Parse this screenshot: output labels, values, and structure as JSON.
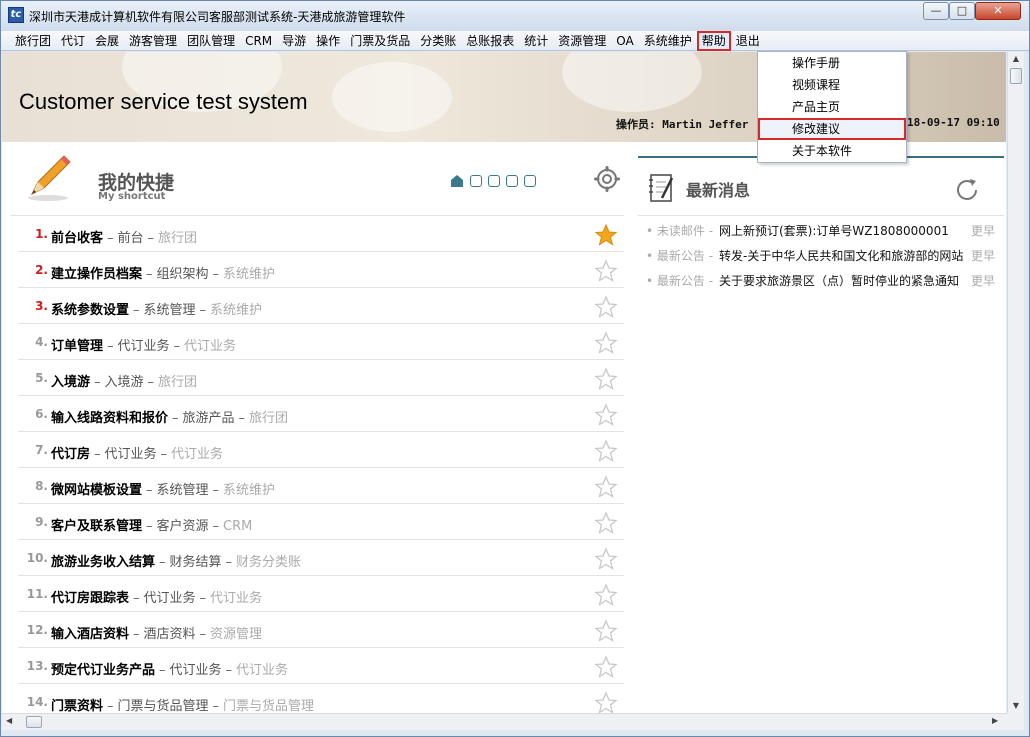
{
  "window": {
    "title": "深圳市天港成计算机软件有限公司客服部测试系统-天港成旅游管理软件",
    "app_icon": "tgc-logo-icon",
    "controls": {
      "minimize": "—",
      "maximize": "□",
      "close": "✕"
    }
  },
  "menubar": {
    "items": [
      "旅行团",
      "代订",
      "会展",
      "游客管理",
      "团队管理",
      "CRM",
      "导游",
      "操作",
      "门票及货品",
      "分类账",
      "总账报表",
      "统计",
      "资源管理",
      "OA",
      "系统维护",
      "帮助",
      "退出"
    ],
    "active": "帮助"
  },
  "help_menu": {
    "items": [
      "操作手册",
      "视频课程",
      "产品主页",
      "修改建议",
      "关于本软件"
    ],
    "highlighted": "修改建议"
  },
  "banner": {
    "title": "Customer service test system",
    "operator": "操作员: Martin Jeffer",
    "datetime": "18-09-17 09:10"
  },
  "shortcuts": {
    "title": "我的快捷",
    "subtitle": "My shortcut",
    "page_count": 5,
    "current_page": 1,
    "items": [
      {
        "num": "1.",
        "name": "前台收客",
        "module": "前台",
        "parent": "旅行团",
        "starred": true,
        "highlight_num": true
      },
      {
        "num": "2.",
        "name": "建立操作员档案",
        "module": "组织架构",
        "parent": "系统维护",
        "starred": false,
        "highlight_num": true
      },
      {
        "num": "3.",
        "name": "系统参数设置",
        "module": "系统管理",
        "parent": "系统维护",
        "starred": false,
        "highlight_num": true
      },
      {
        "num": "4.",
        "name": "订单管理",
        "module": "代订业务",
        "parent": "代订业务",
        "starred": false,
        "highlight_num": false
      },
      {
        "num": "5.",
        "name": "入境游",
        "module": "入境游",
        "parent": "旅行团",
        "starred": false,
        "highlight_num": false
      },
      {
        "num": "6.",
        "name": "输入线路资料和报价",
        "module": "旅游产品",
        "parent": "旅行团",
        "starred": false,
        "highlight_num": false
      },
      {
        "num": "7.",
        "name": "代订房",
        "module": "代订业务",
        "parent": "代订业务",
        "starred": false,
        "highlight_num": false
      },
      {
        "num": "8.",
        "name": "微网站模板设置",
        "module": "系统管理",
        "parent": "系统维护",
        "starred": false,
        "highlight_num": false
      },
      {
        "num": "9.",
        "name": "客户及联系管理",
        "module": "客户资源",
        "parent": "CRM",
        "starred": false,
        "highlight_num": false
      },
      {
        "num": "10.",
        "name": "旅游业务收入结算",
        "module": "财务结算",
        "parent": "财务分类账",
        "starred": false,
        "highlight_num": false
      },
      {
        "num": "11.",
        "name": "代订房跟踪表",
        "module": "代订业务",
        "parent": "代订业务",
        "starred": false,
        "highlight_num": false
      },
      {
        "num": "12.",
        "name": "输入酒店资料",
        "module": "酒店资料",
        "parent": "资源管理",
        "starred": false,
        "highlight_num": false
      },
      {
        "num": "13.",
        "name": "预定代订业务产品",
        "module": "代订业务",
        "parent": "代订业务",
        "starred": false,
        "highlight_num": false
      },
      {
        "num": "14.",
        "name": "门票资料",
        "module": "门票与货品管理",
        "parent": "门票与货品管理",
        "starred": false,
        "highlight_num": false
      }
    ]
  },
  "news": {
    "title": "最新消息",
    "items": [
      {
        "category": "未读邮件",
        "text": "网上新预订(套票):订单号WZ1808000001",
        "more": "更早"
      },
      {
        "category": "最新公告",
        "text": "转发-关于中华人民共和国文化和旅游部的网站",
        "more": "更早"
      },
      {
        "category": "最新公告",
        "text": "关于要求旅游景区（点）暂时停业的紧急通知",
        "more": "更早"
      }
    ]
  },
  "colors": {
    "accent_teal": "#3b7a8a",
    "highlight_red": "#d8282a",
    "star_gold": "#f2a81c"
  }
}
